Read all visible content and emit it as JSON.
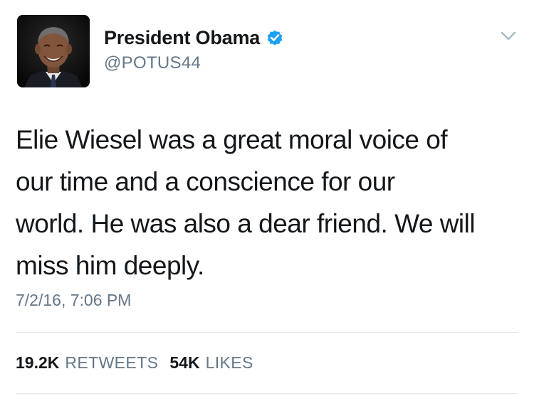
{
  "author": {
    "display_name": "President Obama",
    "handle": "@POTUS44",
    "verified_icon": "verified-badge-icon",
    "avatar": "profile-photo"
  },
  "menu_icon": "chevron-down-icon",
  "tweet": {
    "text": "Elie Wiesel was a great moral voice of\nour time and a conscience for our\nworld. He was also a dear friend. We will\nmiss him deeply.",
    "timestamp": "7/2/16, 7:06 PM"
  },
  "stats": {
    "retweets_count": "19.2K",
    "retweets_label": "RETWEETS",
    "likes_count": "54K",
    "likes_label": "LIKES"
  },
  "colors": {
    "text_primary": "#14171a",
    "text_secondary": "#657786",
    "verified_blue": "#1da1f2",
    "divider": "#e1e8ed"
  }
}
